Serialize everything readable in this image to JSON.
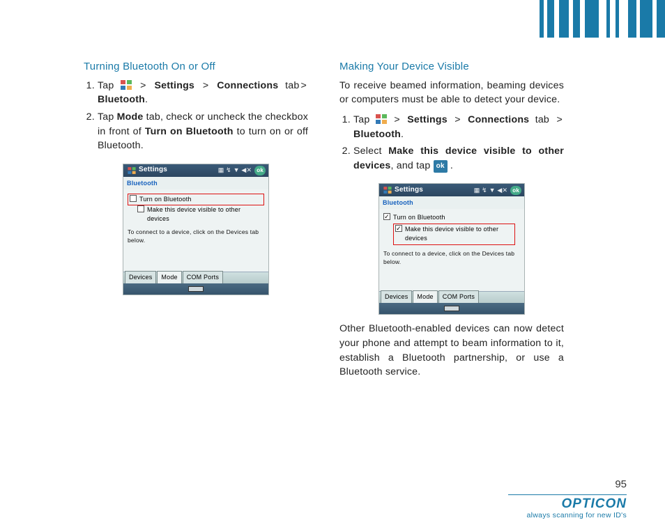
{
  "page_number": "95",
  "branding": {
    "logo": "OPTICON",
    "tagline": "always scanning for new ID's"
  },
  "left": {
    "heading": "Turning Bluetooth On or Off",
    "step1": {
      "pre": "Tap ",
      "settings": "Settings",
      "conn": "Connections",
      "tab": " tab",
      "bt": "Bluetooth"
    },
    "step2": {
      "a": "Tap ",
      "mode": "Mode",
      "b": " tab, check or uncheck the checkbox in front of ",
      "turnon": "Turn on Bluetooth",
      "c": " to turn on or off Bluetooth."
    },
    "shot": {
      "title": "Settings",
      "ok": "ok",
      "section": "Bluetooth",
      "opt1": "Turn on Bluetooth",
      "opt2": "Make this device visible to other devices",
      "hint": "To connect to a device, click on the Devices tab below.",
      "tabs": [
        "Devices",
        "Mode",
        "COM Ports"
      ]
    }
  },
  "right": {
    "heading": "Making Your Device Visible",
    "intro": "To receive beamed information, beaming devices or computers must be able to detect your device.",
    "step1": {
      "pre": "Tap ",
      "settings": "Settings",
      "conn": "Connections",
      "tab": " tab ",
      "bt": "Bluetooth"
    },
    "step2": {
      "a": "Select ",
      "make": "Make this device visible to other devices",
      "b": ", and tap ",
      "ok": "ok",
      "c": " ."
    },
    "shot": {
      "title": "Settings",
      "ok": "ok",
      "section": "Bluetooth",
      "opt1": "Turn on Bluetooth",
      "opt2": "Make this device visible to other devices",
      "hint": "To connect to a device, click on the Devices tab below.",
      "tabs": [
        "Devices",
        "Mode",
        "COM Ports"
      ]
    },
    "outro": "Other Bluetooth-enabled devices can now detect your phone and attempt to beam information to it, establish a Bluetooth partnership, or use a Bluetooth service."
  },
  "gt": ">"
}
